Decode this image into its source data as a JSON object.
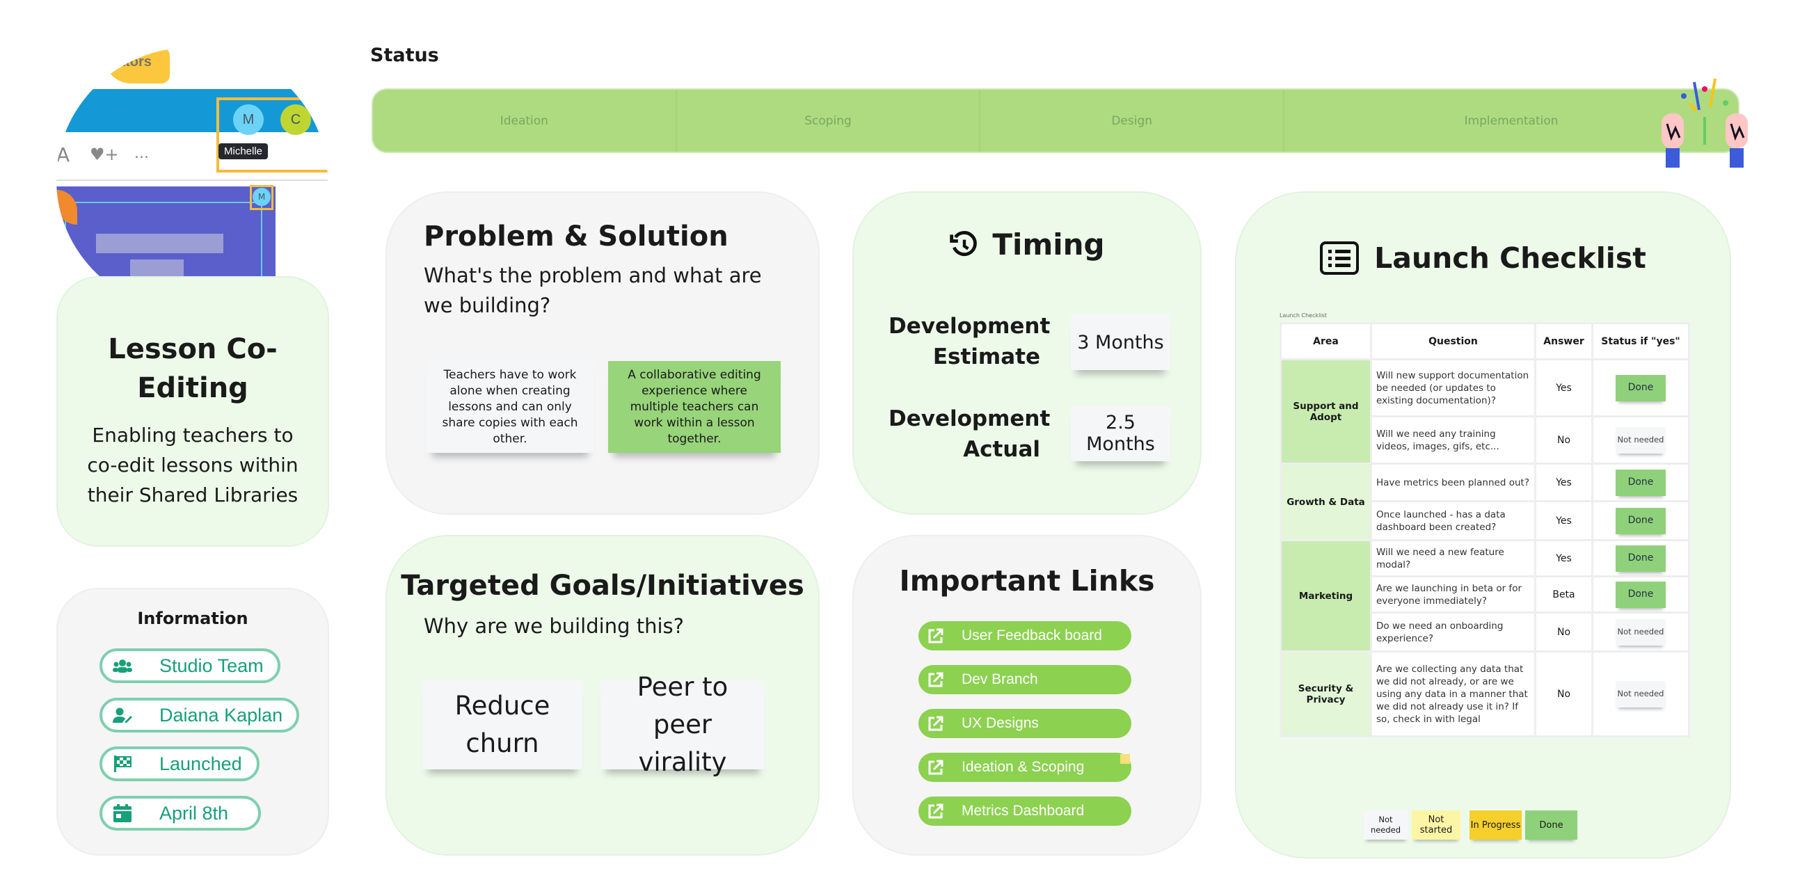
{
  "preview": {
    "tag_partial": "ators",
    "avatar_m": "M",
    "avatar_c": "C",
    "tooltip": "Michelle",
    "toolbar_more": "...",
    "toolbar_a": "A"
  },
  "lesson": {
    "title": "Lesson Co-Editing",
    "description": "Enabling teachers to co-edit lessons within their Shared Libraries"
  },
  "information": {
    "title": "Information",
    "items": [
      {
        "label": "Studio Team",
        "icon": "users-icon"
      },
      {
        "label": "Daiana Kaplan",
        "icon": "user-edit-icon"
      },
      {
        "label": "Launched",
        "icon": "checkered-flag-icon"
      },
      {
        "label": "April 8th",
        "icon": "calendar-icon"
      }
    ]
  },
  "status": {
    "title": "Status",
    "stages": [
      "Ideation",
      "Scoping",
      "Design",
      "Implementation"
    ],
    "color": "#aedb80"
  },
  "problem": {
    "title": "Problem & Solution",
    "subtitle": "What's the problem and what are we building?",
    "problem_note": "Teachers have to work alone when creating lessons and can only share copies with each other.",
    "solution_note": "A collaborative editing experience where multiple teachers can work within a lesson together."
  },
  "timing": {
    "title": "Timing",
    "icon": "history-icon",
    "rows": [
      {
        "label": "Development Estimate",
        "value": "3 Months"
      },
      {
        "label": "Development Actual",
        "value": "2.5 Months"
      }
    ]
  },
  "goals": {
    "title": "Targeted Goals/Initiatives",
    "subtitle": "Why are we building this?",
    "notes": [
      "Reduce churn",
      "Peer to peer virality"
    ]
  },
  "links": {
    "title": "Important Links",
    "items": [
      "User Feedback board",
      "Dev Branch",
      "UX Designs",
      "Ideation & Scoping",
      "Metrics Dashboard"
    ]
  },
  "checklist": {
    "title": "Launch Checklist",
    "table_caption": "Launch Checklist",
    "headers": [
      "Area",
      "Question",
      "Answer",
      "Status if \"yes\""
    ],
    "groups": [
      {
        "area": "Support and Adopt",
        "color": "#c8ecb0",
        "rows": [
          {
            "q": "Will new support documentation be needed (or updates to existing documentation)?",
            "a": "Yes",
            "s": "Done"
          },
          {
            "q": "Will we need any training videos, images, gifs, etc...",
            "a": "No",
            "s": "Not needed"
          }
        ]
      },
      {
        "area": "Growth & Data",
        "color": "#e3f6d8",
        "rows": [
          {
            "q": "Have metrics been planned out?",
            "a": "Yes",
            "s": "Done"
          },
          {
            "q": "Once launched - has a data dashboard been created?",
            "a": "Yes",
            "s": "Done"
          }
        ]
      },
      {
        "area": "Marketing",
        "color": "#c8ecb0",
        "rows": [
          {
            "q": "Will we need a new feature modal?",
            "a": "Yes",
            "s": "Done"
          },
          {
            "q": "Are we launching in beta or for everyone immediately?",
            "a": "Beta",
            "s": "Done"
          },
          {
            "q": "Do we need an onboarding experience?",
            "a": "No",
            "s": "Not needed"
          }
        ]
      },
      {
        "area": "Security & Privacy",
        "color": "#e3f6d8",
        "rows": [
          {
            "q": "Are we collecting any data that we did not already, or are we using any data in a manner that we did not already use it in? If so, check in with legal",
            "a": "No",
            "s": "Not needed"
          }
        ]
      }
    ],
    "legend": [
      {
        "label": "Not needed",
        "color": "#f4f6f8"
      },
      {
        "label": "Not started",
        "color": "#fdf5a6"
      },
      {
        "label": "In Progress",
        "color": "#f5cf2c"
      },
      {
        "label": "Done",
        "color": "#8fd17a"
      }
    ]
  }
}
